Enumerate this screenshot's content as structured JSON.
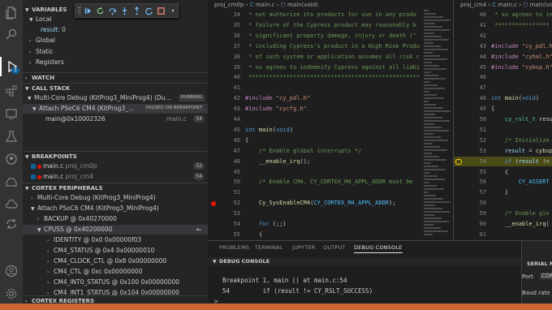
{
  "sidebar": {
    "variables_header": "VARIABLES",
    "local_label": "Local",
    "result_name": "result:",
    "result_value": "0",
    "global_label": "Global",
    "static_label": "Static",
    "registers_label": "Registers",
    "watch_header": "WATCH",
    "callstack_header": "CALL STACK",
    "session_label": "Multi-Core Debug (KitProg3_MiniProg4) (Du...",
    "session_state": "RUNNING",
    "thread_label": "Attach PSoC6 CM4 (KitProg3_...",
    "thread_state": "PAUSED ON BREAKPOINT",
    "frame_label": "main@0x10002326",
    "frame_file": "main.c",
    "frame_line": "54",
    "breakpoints_header": "BREAKPOINTS",
    "breakpoints": [
      {
        "file": "main.c",
        "path": "proj_cm0p",
        "line": "52"
      },
      {
        "file": "main.c",
        "path": "proj_cm4",
        "line": "54"
      }
    ],
    "peripherals_header": "CORTEX PERIPHERALS",
    "peripherals": [
      {
        "label": "Multi-Core Debug (KitProg3_MiniProg4)"
      },
      {
        "label": "Attach PSoC6 CM4 (KitProg3_MiniProg4)"
      },
      {
        "label": "BACKUP @ 0x40270000"
      },
      {
        "label": "CPUSS @ 0x40200000"
      },
      {
        "label": "IDENTITY @ 0x0 0x00000f03"
      },
      {
        "label": "CM4_STATUS @ 0x4 0x00000010"
      },
      {
        "label": "CM4_CLOCK_CTL @ 0x8 0x00000000"
      },
      {
        "label": "CM4_CTL @ 0xc 0x00000000"
      },
      {
        "label": "CM4_INT0_STATUS @ 0x100 0x00000000"
      },
      {
        "label": "CM4_INT1_STATUS @ 0x104 0x00000000"
      }
    ],
    "registers_footer": "CORTEX REGISTERS"
  },
  "editor1": {
    "breadcrumb": [
      "proj_cm0p",
      "main.c",
      "main(void)"
    ],
    "lines": [
      {
        "n": "34",
        "t": " * not authorize its products for use in any produ"
      },
      {
        "n": "35",
        "t": " * failure of the Cypress product may reasonably b"
      },
      {
        "n": "36",
        "t": " * significant property damage, injury or death (\""
      },
      {
        "n": "37",
        "t": " * including Cypress's product in a High Risk Produ"
      },
      {
        "n": "38",
        "t": " * of such system or application assumes all risk c"
      },
      {
        "n": "39",
        "t": " * so agrees to indemnify Cypress against all liabi"
      },
      {
        "n": "40",
        "t": " ****************************************************"
      },
      {
        "n": "41",
        "t": ""
      },
      {
        "n": "42",
        "t": "#include \"cy_pdl.h\""
      },
      {
        "n": "43",
        "t": "#include \"cycfg.h\""
      },
      {
        "n": "44",
        "t": ""
      },
      {
        "n": "45",
        "t": "int main(void)"
      },
      {
        "n": "46",
        "t": "{"
      },
      {
        "n": "47",
        "t": "    /* Enable global interrupts */"
      },
      {
        "n": "48",
        "t": "    __enable_irq();"
      },
      {
        "n": "49",
        "t": ""
      },
      {
        "n": "50",
        "t": "    /* Enable CM4. CY_CORTEX_M4_APPL_ADDR must be"
      },
      {
        "n": "51",
        "t": ""
      },
      {
        "n": "52",
        "t": "    Cy_SysEnableCM4(CY_CORTEX_M4_APPL_ADDR);"
      },
      {
        "n": "53",
        "t": ""
      },
      {
        "n": "54",
        "t": "    for (;;)"
      },
      {
        "n": "55",
        "t": "    {"
      },
      {
        "n": "56",
        "t": "        Cy_SysPm_DeepSleep(CY_SYSPM_WAIT_FOR_INTE"
      },
      {
        "n": "57",
        "t": "    }"
      },
      {
        "n": "58",
        "t": "}"
      }
    ]
  },
  "editor2": {
    "breadcrumb": [
      "proj_cm4",
      "main.c",
      "main(void)"
    ],
    "lines": [
      {
        "n": "40",
        "t": " * so agrees to ind"
      },
      {
        "n": "41",
        "t": " ****************"
      },
      {
        "n": "42",
        "t": ""
      },
      {
        "n": "43",
        "t": "#include \"cy_pdl.h"
      },
      {
        "n": "44",
        "t": "#include \"cyhal.h\""
      },
      {
        "n": "45",
        "t": "#include \"cybsp.h\""
      },
      {
        "n": "46",
        "t": ""
      },
      {
        "n": "47",
        "t": ""
      },
      {
        "n": "48",
        "t": "int main(void)"
      },
      {
        "n": "49",
        "t": "{"
      },
      {
        "n": "50",
        "t": "    cy_rslt_t resu"
      },
      {
        "n": "51",
        "t": ""
      },
      {
        "n": "52",
        "t": "    /* Initialize"
      },
      {
        "n": "53",
        "t": "    result = cybsp"
      },
      {
        "n": "54",
        "t": "    if (result !="
      },
      {
        "n": "55",
        "t": "    {"
      },
      {
        "n": "56",
        "t": "        CY_ASSERT"
      },
      {
        "n": "57",
        "t": "    }"
      },
      {
        "n": "58",
        "t": ""
      },
      {
        "n": "59",
        "t": "    /* Enable glo"
      },
      {
        "n": "60",
        "t": "    __enable_irq("
      },
      {
        "n": "61",
        "t": ""
      },
      {
        "n": "62",
        "t": "    for (;;)"
      },
      {
        "n": "63",
        "t": "    {"
      },
      {
        "n": "64",
        "t": "    }"
      }
    ]
  },
  "panel": {
    "tabs": [
      "PROBLEMS",
      "TERMINAL",
      "JUPYTER",
      "OUTPUT",
      "DEBUG CONSOLE"
    ],
    "active_tab": "DEBUG CONSOLE",
    "console_header": "DEBUG CONSOLE",
    "output": [
      "Breakpoint 1, main () at main.c:54",
      "54         if (result != CY_RSLT_SUCCESS)"
    ],
    "prompt": ">"
  },
  "serial": {
    "header": "SERIAL M",
    "port_label": "Port",
    "port_tab": "COM",
    "baud_label": "Baud rate"
  },
  "colors": {
    "status_bar": "#cc6633",
    "breakpoint": "#e51400",
    "current_line": "#4b4b18",
    "accent": "#0e639c"
  },
  "icons": {
    "activity": [
      "files-icon",
      "search-icon",
      "run-debug-icon",
      "extensions-icon",
      "remote-explorer-icon",
      "testing-icon",
      "github-icon",
      "source-control-icon",
      "cloud-icon",
      "settings-sync-icon",
      "account-icon",
      "gear-icon"
    ],
    "debug_toolbar": [
      "grip-icon",
      "continue-icon",
      "restart-icon",
      "step-over-icon",
      "step-into-icon",
      "step-out-icon",
      "stop-icon"
    ]
  }
}
